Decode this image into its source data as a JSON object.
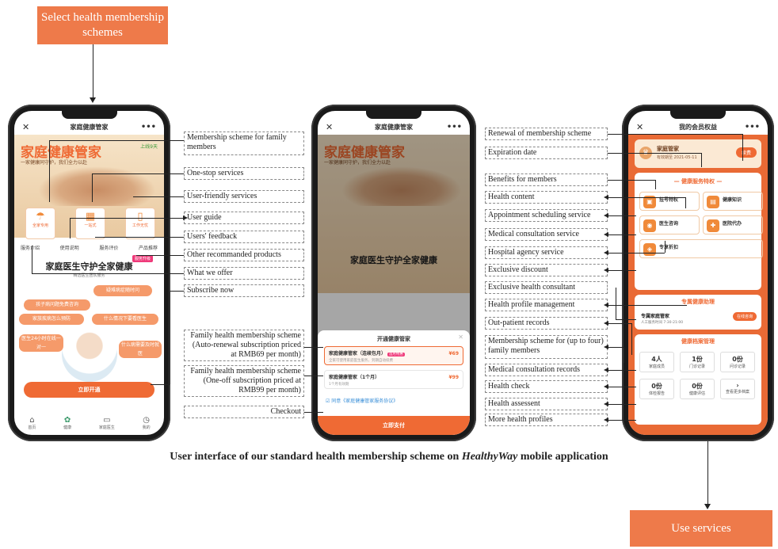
{
  "top_step": "Select health membership schemes",
  "bottom_step": "Use services",
  "caption": {
    "prefix": "User interface of our standard health membership scheme on ",
    "app_name": "HealthyWay",
    "suffix": " mobile application"
  },
  "phone1": {
    "header_title": "家庭健康管家",
    "hero_title": "家庭健康管家",
    "hero_subtitle": "一家健康同守护，我们全力以赴",
    "hero_tag": "上线9天",
    "services": [
      {
        "label": "全家专用",
        "icon": "umbrella-icon"
      },
      {
        "label": "一站式",
        "icon": "grid-icon"
      },
      {
        "label": "工作无忧",
        "icon": "bookmark-icon"
      }
    ],
    "links": [
      "服务介绍",
      "使用说明",
      "服务评价",
      "产品推荐"
    ],
    "offer_title": "家庭医生守护全家健康",
    "offer_badge": "服务升级",
    "offer_sub": "精选医生团队服务",
    "bubbles": [
      "疑难病症随时问",
      "孩子病问题免费咨询",
      "家族疾病怎么预防",
      "什么情况下要看医生",
      "医生24小时在线一对一",
      "什么病需要及时就医"
    ],
    "cta": "立即开通",
    "tabs": [
      {
        "label": "首页",
        "icon": "home-icon"
      },
      {
        "label": "健康",
        "icon": "leaf-icon"
      },
      {
        "label": "家庭医生",
        "icon": "chat-icon"
      },
      {
        "label": "我的",
        "icon": "clock-icon"
      }
    ]
  },
  "phone2": {
    "header_title": "家庭健康管家",
    "sheet_title": "开通健康管家",
    "options": [
      {
        "name": "家庭健康管家（连续包月）",
        "badge": "首月特惠",
        "price": "¥69",
        "desc": "全家可使用家庭医生服务，到期自动续费"
      },
      {
        "name": "家庭健康管家（1个月）",
        "price": "¥99",
        "desc": "1个月有效期"
      }
    ],
    "agree": "同意《家庭健康管家服务协议》",
    "pay": "立即支付"
  },
  "phone3": {
    "header_title": "我的会员权益",
    "member_name": "家庭管家",
    "expire": "有效期至 2021-05-11",
    "renew": "续费",
    "benefit_title": "健康服务特权",
    "benefits": [
      {
        "title": "挂号特权",
        "icon": "calendar-icon"
      },
      {
        "title": "健康知识",
        "icon": "book-icon"
      },
      {
        "title": "医生咨询",
        "icon": "stethoscope-icon"
      },
      {
        "title": "医院代办",
        "icon": "hospital-icon"
      },
      {
        "title": "专享折扣",
        "icon": "tag-icon"
      }
    ],
    "consultant_title": "专属健康助理",
    "consultant_name": "专属家庭管家",
    "consultant_hours": "人工服务时间 7:30-21:00",
    "consultant_btn": "在线咨询",
    "records_title": "健康档案管理",
    "records": [
      {
        "label": "家庭成员",
        "value": "4人"
      },
      {
        "label": "门诊记录",
        "value": "1份"
      },
      {
        "label": "问诊记录",
        "value": "0份"
      },
      {
        "label": "体检报告",
        "value": "0份"
      },
      {
        "label": "健康评估",
        "value": "0份"
      },
      {
        "label": "查看更多档案",
        "value": ""
      }
    ]
  },
  "labels_left": [
    "Membership scheme for family members",
    "One-stop services",
    "User-friendly services",
    "User guide",
    "Users' feedback",
    "Other recommanded products",
    "What we offer",
    "Subscribe now"
  ],
  "labels_mid": [
    "Family health membership scheme (Auto-renewal subscription priced at RMB69 per month)",
    "Family health membership scheme (One-off subscription priced at RMB99 per month)",
    "Checkout"
  ],
  "labels_right": [
    "Renewal of  membership scheme",
    "Expiration date",
    "Benefits for members",
    "Health content",
    "Appointment scheduling service",
    "Medical consultation service",
    "Hospital agency service",
    "Exclusive discount",
    "Exclusive health consultant",
    "Health profile management",
    "Out-patient records",
    "Membership scheme for (up to four) family members",
    "Medical consultation records",
    "Health check",
    "Health assessent",
    "More health profiles"
  ]
}
